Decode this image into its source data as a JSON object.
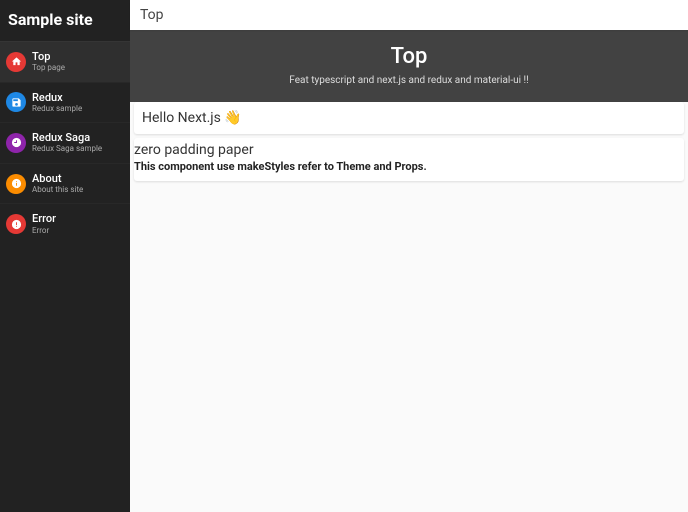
{
  "sidebar": {
    "title": "Sample site",
    "items": [
      {
        "label": "Top",
        "sub": "Top page"
      },
      {
        "label": "Redux",
        "sub": "Redux sample"
      },
      {
        "label": "Redux Saga",
        "sub": "Redux Saga sample"
      },
      {
        "label": "About",
        "sub": "About this site"
      },
      {
        "label": "Error",
        "sub": "Error"
      }
    ]
  },
  "topbar": {
    "title": "Top"
  },
  "hero": {
    "title": "Top",
    "sub": "Feat typescript and next.js and redux and material-ui !!"
  },
  "greet": "Hello Next.js 👋",
  "zero": {
    "title": "zero padding paper",
    "body": "This component use makeStyles refer to Theme and Props."
  }
}
